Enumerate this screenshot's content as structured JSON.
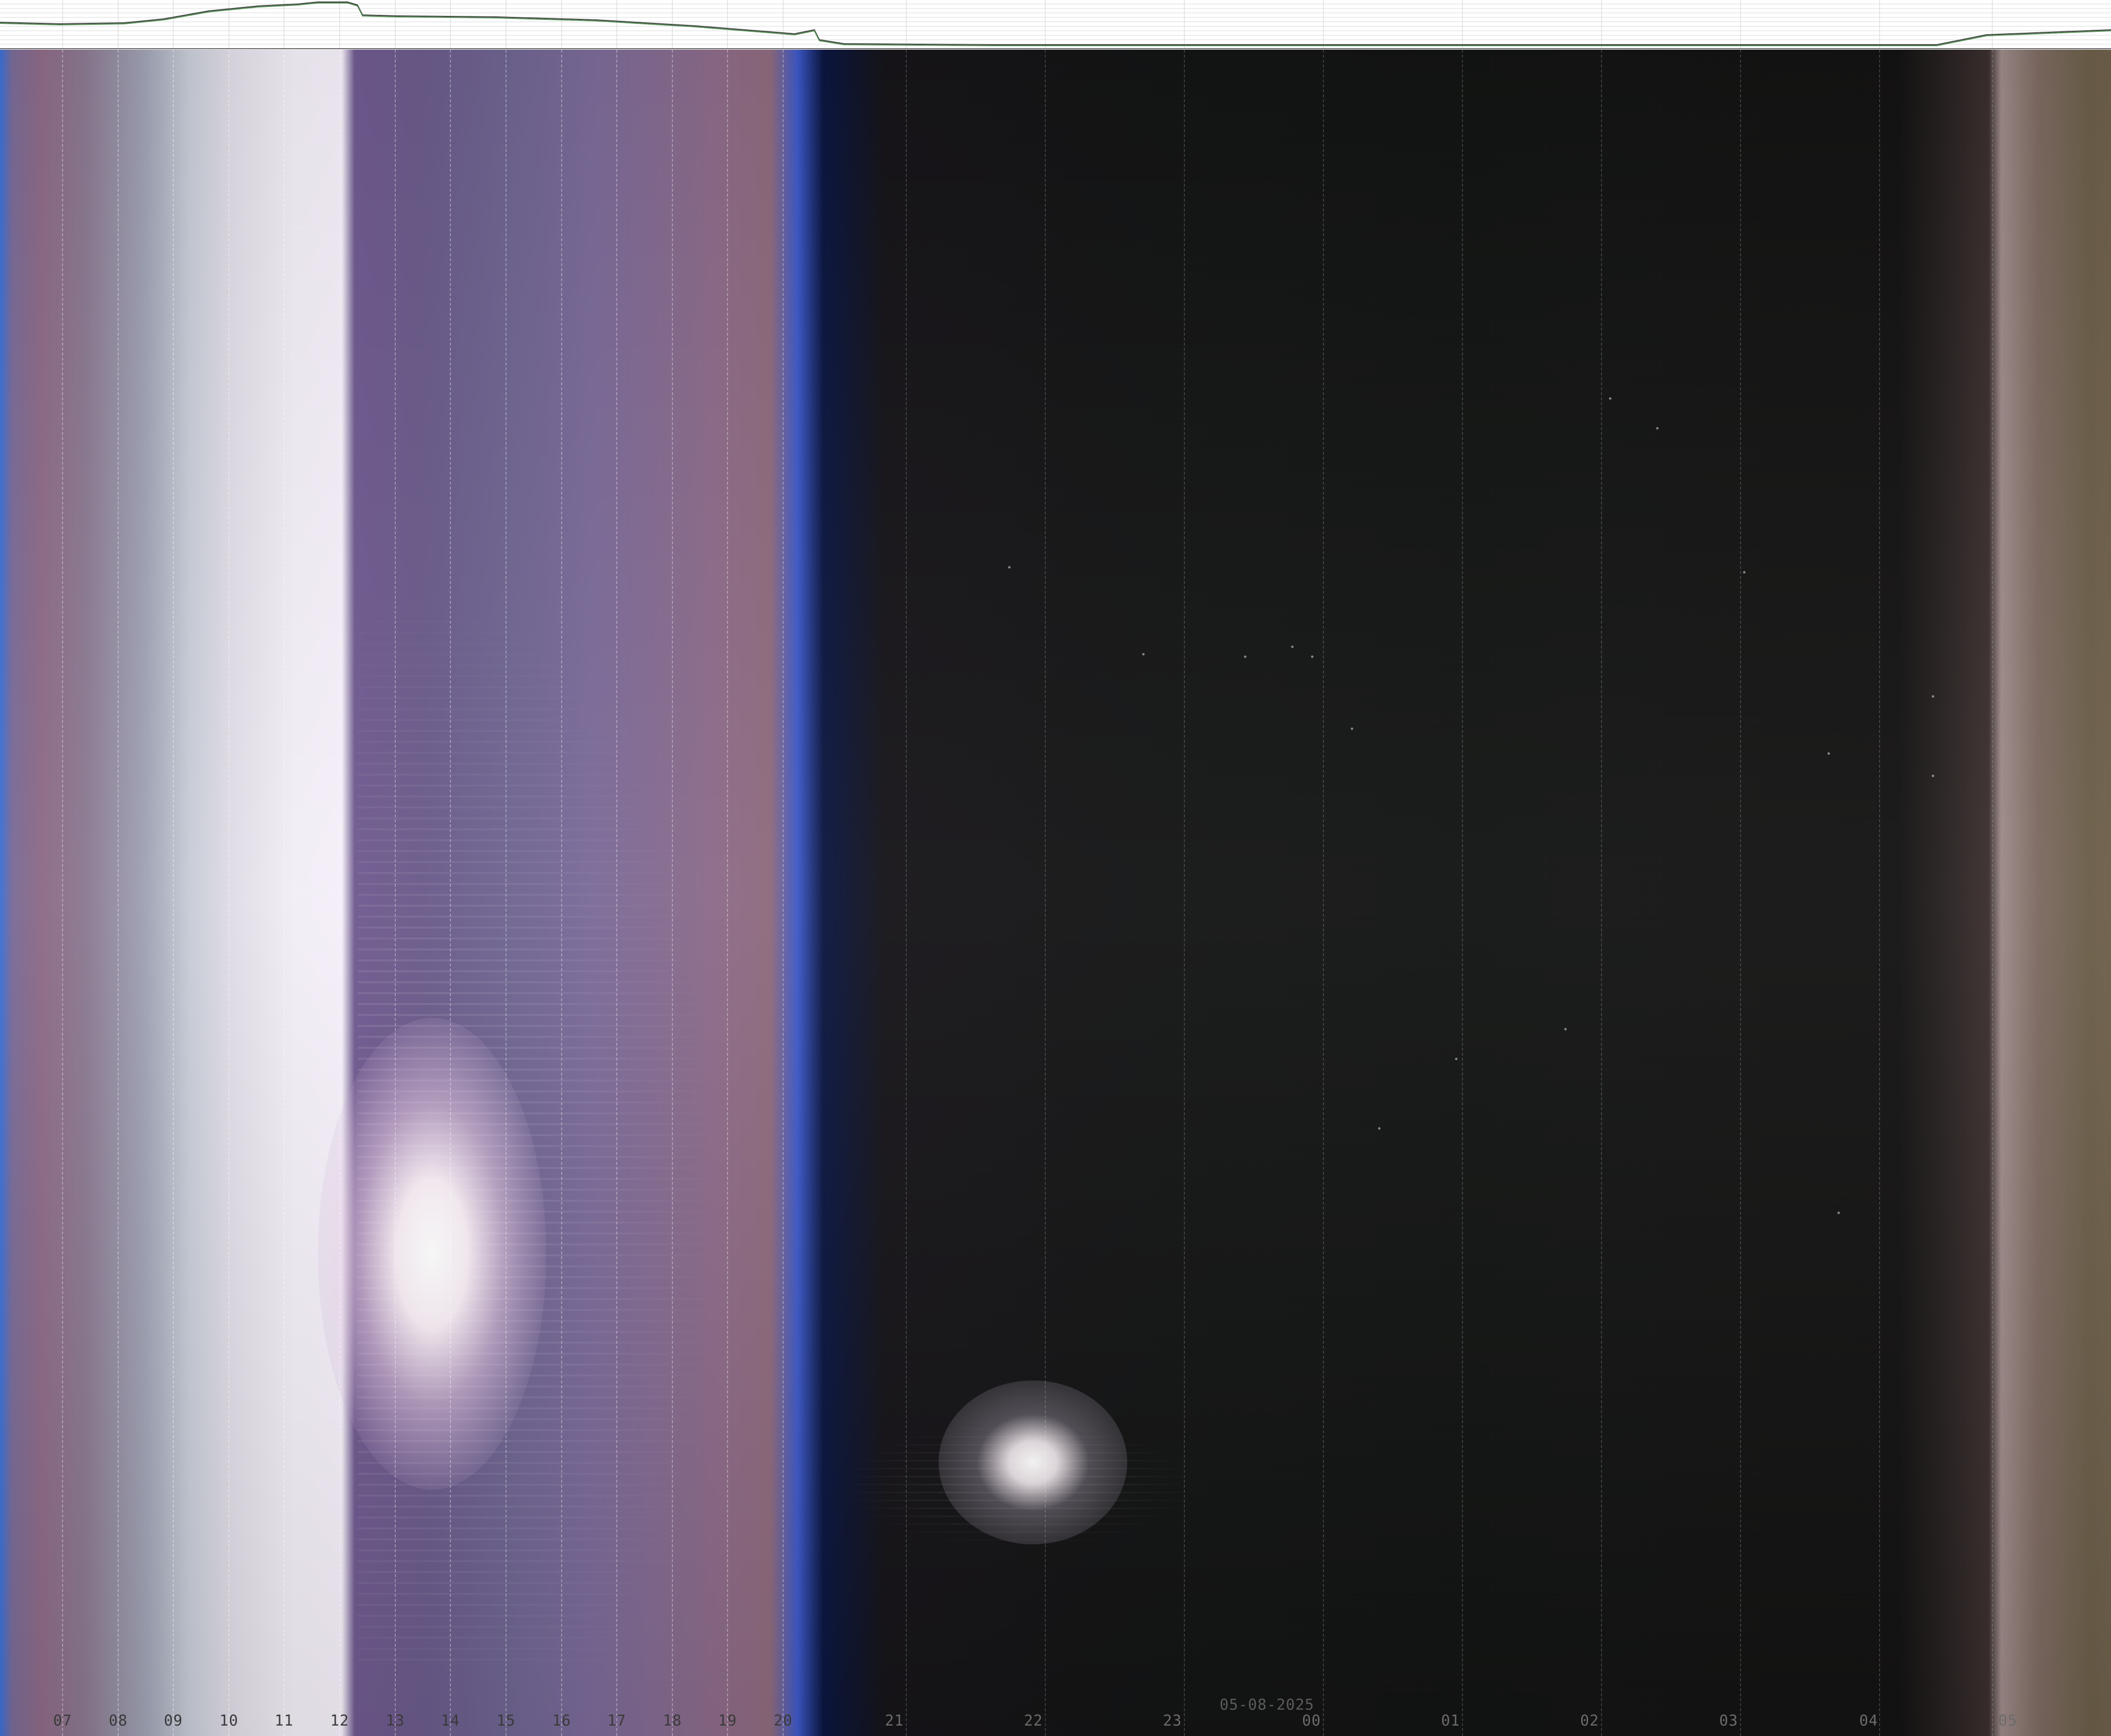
{
  "date_label": "05-08-2025",
  "hour_labels": [
    "07",
    "08",
    "09",
    "10",
    "11",
    "12",
    "13",
    "14",
    "15",
    "16",
    "17",
    "18",
    "19",
    "20",
    "21",
    "22",
    "23",
    "00",
    "01",
    "02",
    "03",
    "04",
    "05"
  ],
  "colors": {
    "graph_background": "#ffffff",
    "graph_line_primary": "#444444",
    "graph_line_secondary": "#4f8a4f",
    "day_sky": "#e0dce6",
    "afternoon_sky": "#6e6490",
    "twilight_blue": "#3c58c8",
    "night_sky": "#131414",
    "dawn_sky": "#9c8a88"
  },
  "features": {
    "sun_glare": "sun",
    "moon_glare": "moon"
  }
}
